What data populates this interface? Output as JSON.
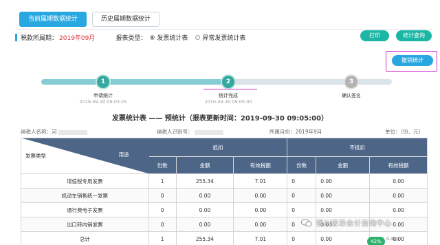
{
  "tabs": [
    {
      "label": "当前属期数据统计",
      "active": true
    },
    {
      "label": "历史属期数据统计",
      "active": false
    }
  ],
  "info": {
    "period_label": "税款所属期：",
    "period_value": "2019年09月",
    "report_type_label": "报表类型：",
    "option_1": "发票统计表",
    "option_2": "异常发票统计表"
  },
  "buttons": {
    "print": "打印",
    "query": "统计查询",
    "cancel": "撤销统计"
  },
  "steps": [
    {
      "num": "1",
      "label": "申请统计",
      "time": "2019-09-30 09:03:25",
      "state": "done"
    },
    {
      "num": "2",
      "label": "统计完成",
      "time": "2019-09-30 09:05:00",
      "state": "done"
    },
    {
      "num": "3",
      "label": "确认签名",
      "time": "",
      "state": "todo"
    }
  ],
  "report": {
    "title": "发票统计表 —— 预统计（报表更新时间：2019-09-30 09:05:00）",
    "taxpayer_name_label": "纳税人名称：河",
    "taxpayer_id_label": "纳税人识别号：",
    "tax_month": "所属月份：2019年9月",
    "unit": "单位：（份、元）"
  },
  "table": {
    "corner_top": "用途",
    "corner_bottom": "发票类型",
    "group_1": "抵扣",
    "group_2": "不抵扣",
    "columns": [
      "份数",
      "金额",
      "有效税额",
      "份数",
      "金额",
      "有效税额"
    ],
    "rows": [
      {
        "label": "增值税专用发票",
        "cells": [
          "1",
          "255.34",
          "7.01",
          "0",
          "0.00",
          "0.00"
        ]
      },
      {
        "label": "机动车销售统一发票",
        "cells": [
          "0",
          "0.00",
          "0.00",
          "0",
          "0.00",
          "0.00"
        ]
      },
      {
        "label": "通行费电子发票",
        "cells": [
          "0",
          "0.00",
          "0.00",
          "0",
          "0.00",
          "0.00"
        ]
      },
      {
        "label": "出口转内销发票",
        "cells": [
          "0",
          "0.00",
          "0.00",
          "0",
          "0.00",
          "0.00"
        ]
      },
      {
        "label": "总计",
        "cells": [
          "1",
          "255.34",
          "7.01",
          "0",
          "0.00",
          "0.00"
        ]
      }
    ]
  },
  "watermark": "银川容泽会计咨询中心",
  "overlay": {
    "badge": "42%",
    "speed": "0.4K/s"
  },
  "colors": {
    "accent": "#29a7e1",
    "teal": "#1bb7a4",
    "highlight": "#cc33cc",
    "header": "#4d6688",
    "period": "#d9323a"
  }
}
